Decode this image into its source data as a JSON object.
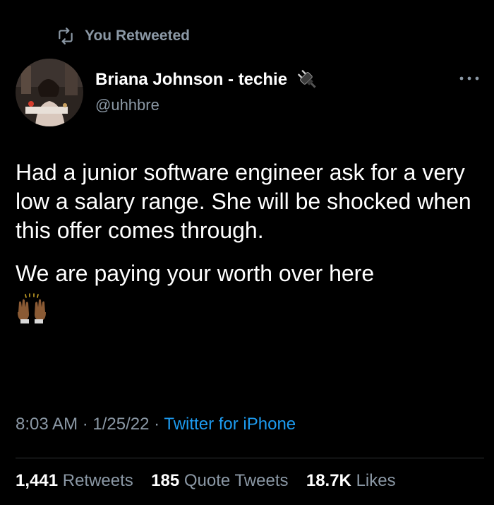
{
  "retweet_context": {
    "label": "You Retweeted",
    "icon": "retweet-icon"
  },
  "author": {
    "display_name": "Briana Johnson - techie",
    "handle": "@uhhbre",
    "name_icon": "electric-plug-emoji"
  },
  "tweet": {
    "paragraphs": [
      "Had a junior software engineer ask for a very low a salary range. She will be shocked when this offer comes through.",
      "We are paying your worth over here"
    ],
    "emoji": "raising-hands-emoji"
  },
  "meta": {
    "time": "8:03 AM",
    "separator": "·",
    "date": "1/25/22",
    "source": "Twitter for iPhone"
  },
  "stats": {
    "retweets_count": "1,441",
    "retweets_label": "Retweets",
    "quotes_count": "185",
    "quotes_label": "Quote Tweets",
    "likes_count": "18.7K",
    "likes_label": "Likes"
  },
  "colors": {
    "background": "#000000",
    "text_primary": "#ffffff",
    "text_secondary": "#8b98a5",
    "link": "#1d9bf0",
    "divider": "#2f3336"
  }
}
